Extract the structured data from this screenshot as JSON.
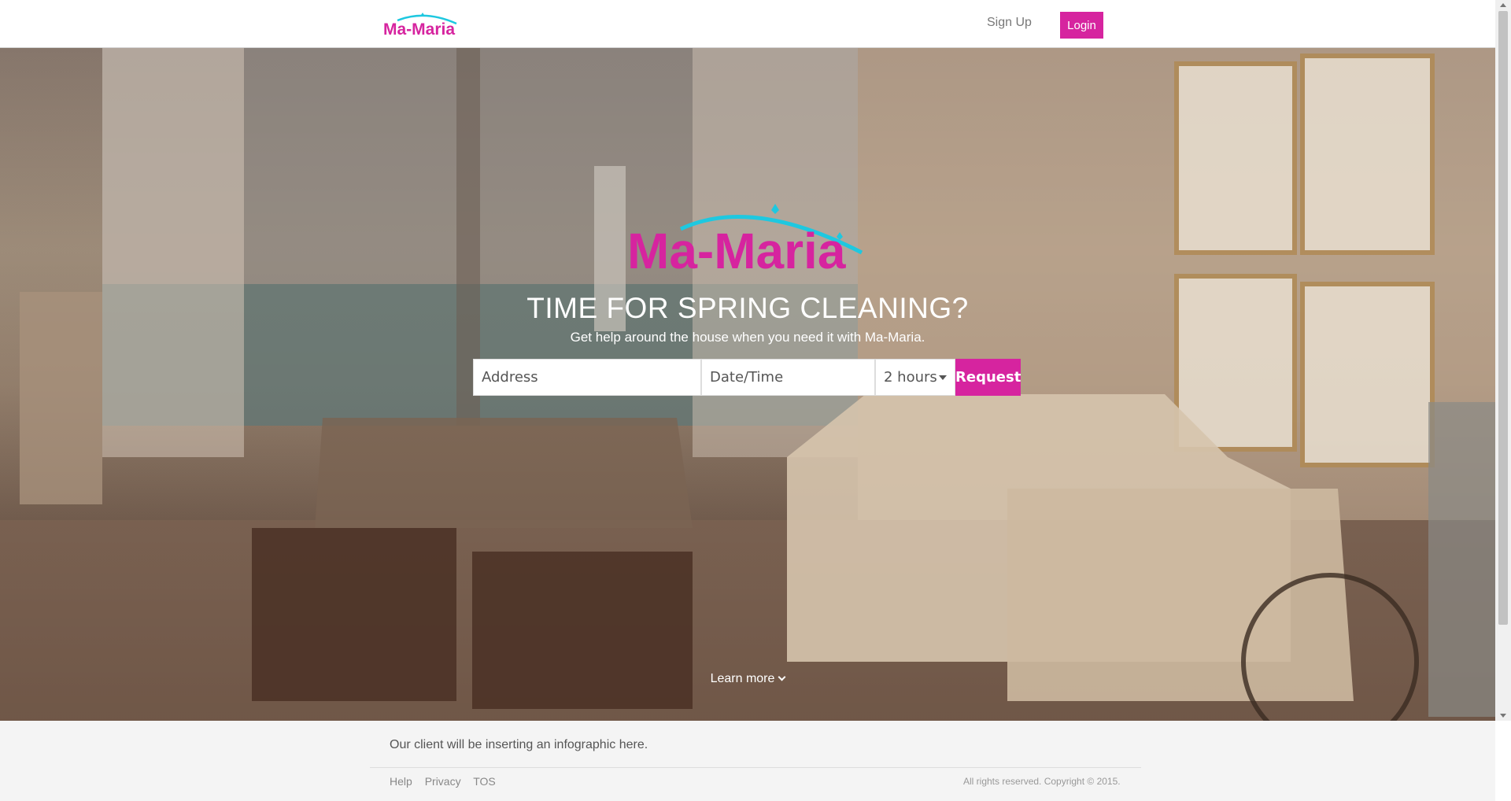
{
  "brand": {
    "name": "Ma-Maria",
    "accent": "#d6249f",
    "swoosh": "#1ec8e0"
  },
  "header": {
    "signup_label": "Sign Up",
    "login_label": "Login"
  },
  "hero": {
    "headline": "TIME FOR SPRING CLEANING?",
    "subline": "Get help around the house when you need it with Ma-Maria.",
    "search": {
      "address_placeholder": "Address",
      "datetime_placeholder": "Date/Time",
      "hours_value": "2 hours",
      "request_label": "Request"
    },
    "learn_more": "Learn more"
  },
  "footer": {
    "infographic_note": "Our client will be inserting an infographic here.",
    "links": [
      "Help",
      "Privacy",
      "TOS"
    ],
    "copyright": "All rights reserved. Copyright © 2015."
  }
}
